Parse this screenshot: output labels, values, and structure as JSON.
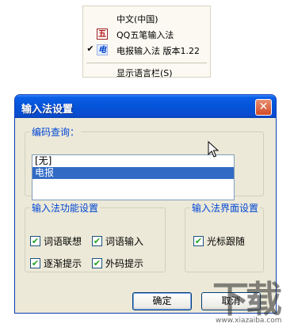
{
  "lang_menu": {
    "items": [
      {
        "label": "中文(中国)",
        "icon": "",
        "checked": false
      },
      {
        "label": "QQ五笔输入法",
        "icon": "五",
        "checked": false
      },
      {
        "label": "电报输入法 版本1.22",
        "icon": "电",
        "checked": true
      },
      {
        "label": "显示语言栏(S)",
        "icon": "",
        "checked": false
      }
    ],
    "check_mark": "✔"
  },
  "dialog": {
    "title": "输入法设置",
    "close_symbol": "✕",
    "code_query": {
      "legend": "编码查询：",
      "items": [
        "[无]",
        "电报"
      ],
      "selected_index": 1
    },
    "function_group": {
      "legend": "输入法功能设置",
      "options": [
        {
          "label": "词语联想",
          "checked": true
        },
        {
          "label": "词语输入",
          "checked": true
        },
        {
          "label": "逐渐提示",
          "checked": true
        },
        {
          "label": "外码提示",
          "checked": true
        }
      ]
    },
    "ui_group": {
      "legend": "输入法界面设置",
      "options": [
        {
          "label": "光标跟随",
          "checked": true
        }
      ]
    },
    "ok_label": "确定",
    "cancel_label": "取消"
  },
  "watermark": {
    "main": "下载",
    "sub": "www.xiazaiba.com"
  },
  "colors": {
    "title_bar": "#0453d8",
    "dialog_bg": "#ece9d8",
    "group_legend": "#0046d5",
    "selection": "#316ac5",
    "close_button": "#d34a26",
    "checkmark": "#21a121"
  }
}
